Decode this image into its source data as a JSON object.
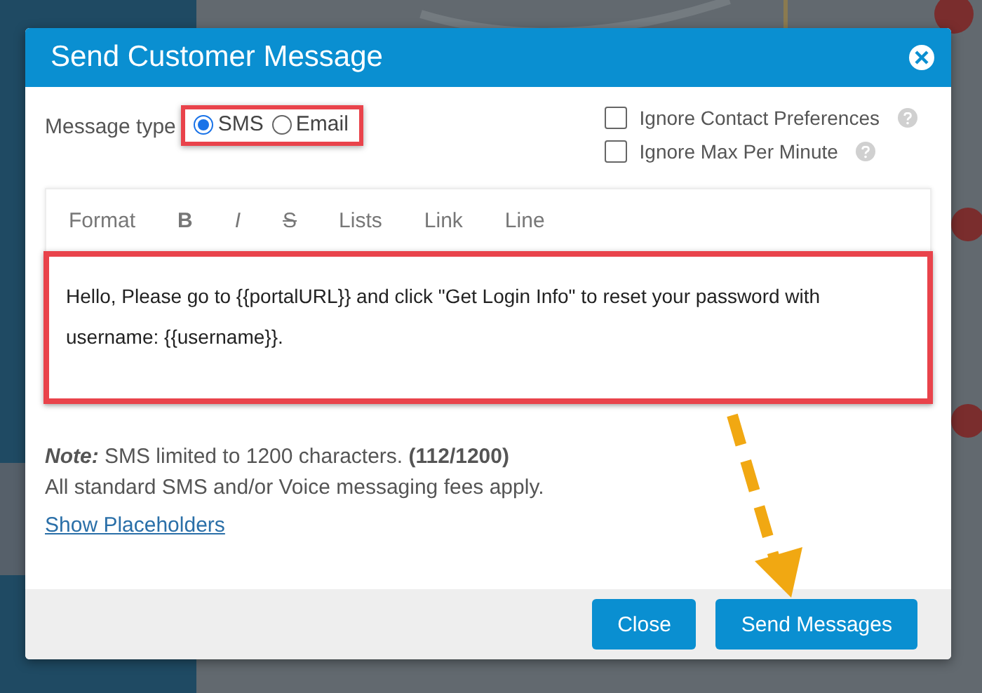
{
  "dialog": {
    "title": "Send Customer Message"
  },
  "message_type": {
    "label": "Message type",
    "options": [
      {
        "label": "SMS",
        "selected": true
      },
      {
        "label": "Email",
        "selected": false
      }
    ]
  },
  "options": [
    {
      "label": "Ignore Contact Preferences",
      "checked": false
    },
    {
      "label": "Ignore Max Per Minute",
      "checked": false
    }
  ],
  "toolbar": [
    {
      "label": "Format",
      "kind": "text"
    },
    {
      "label": "B",
      "kind": "bold"
    },
    {
      "label": "I",
      "kind": "italic"
    },
    {
      "label": "S",
      "kind": "strike"
    },
    {
      "label": "Lists",
      "kind": "text"
    },
    {
      "label": "Link",
      "kind": "text"
    },
    {
      "label": "Line",
      "kind": "text"
    }
  ],
  "message": "Hello, Please go to {{portalURL}} and click \"Get Login Info\" to reset your password with username: {{username}}.",
  "note": "**Note:** SMS limited to 1200 characters. **(112/1200)**",
  "fees": "All standard SMS and/or Voice messaging fees apply.",
  "placeholders_link": "Show Placeholders",
  "buttons": [
    "Close",
    "Send Messages"
  ]
}
